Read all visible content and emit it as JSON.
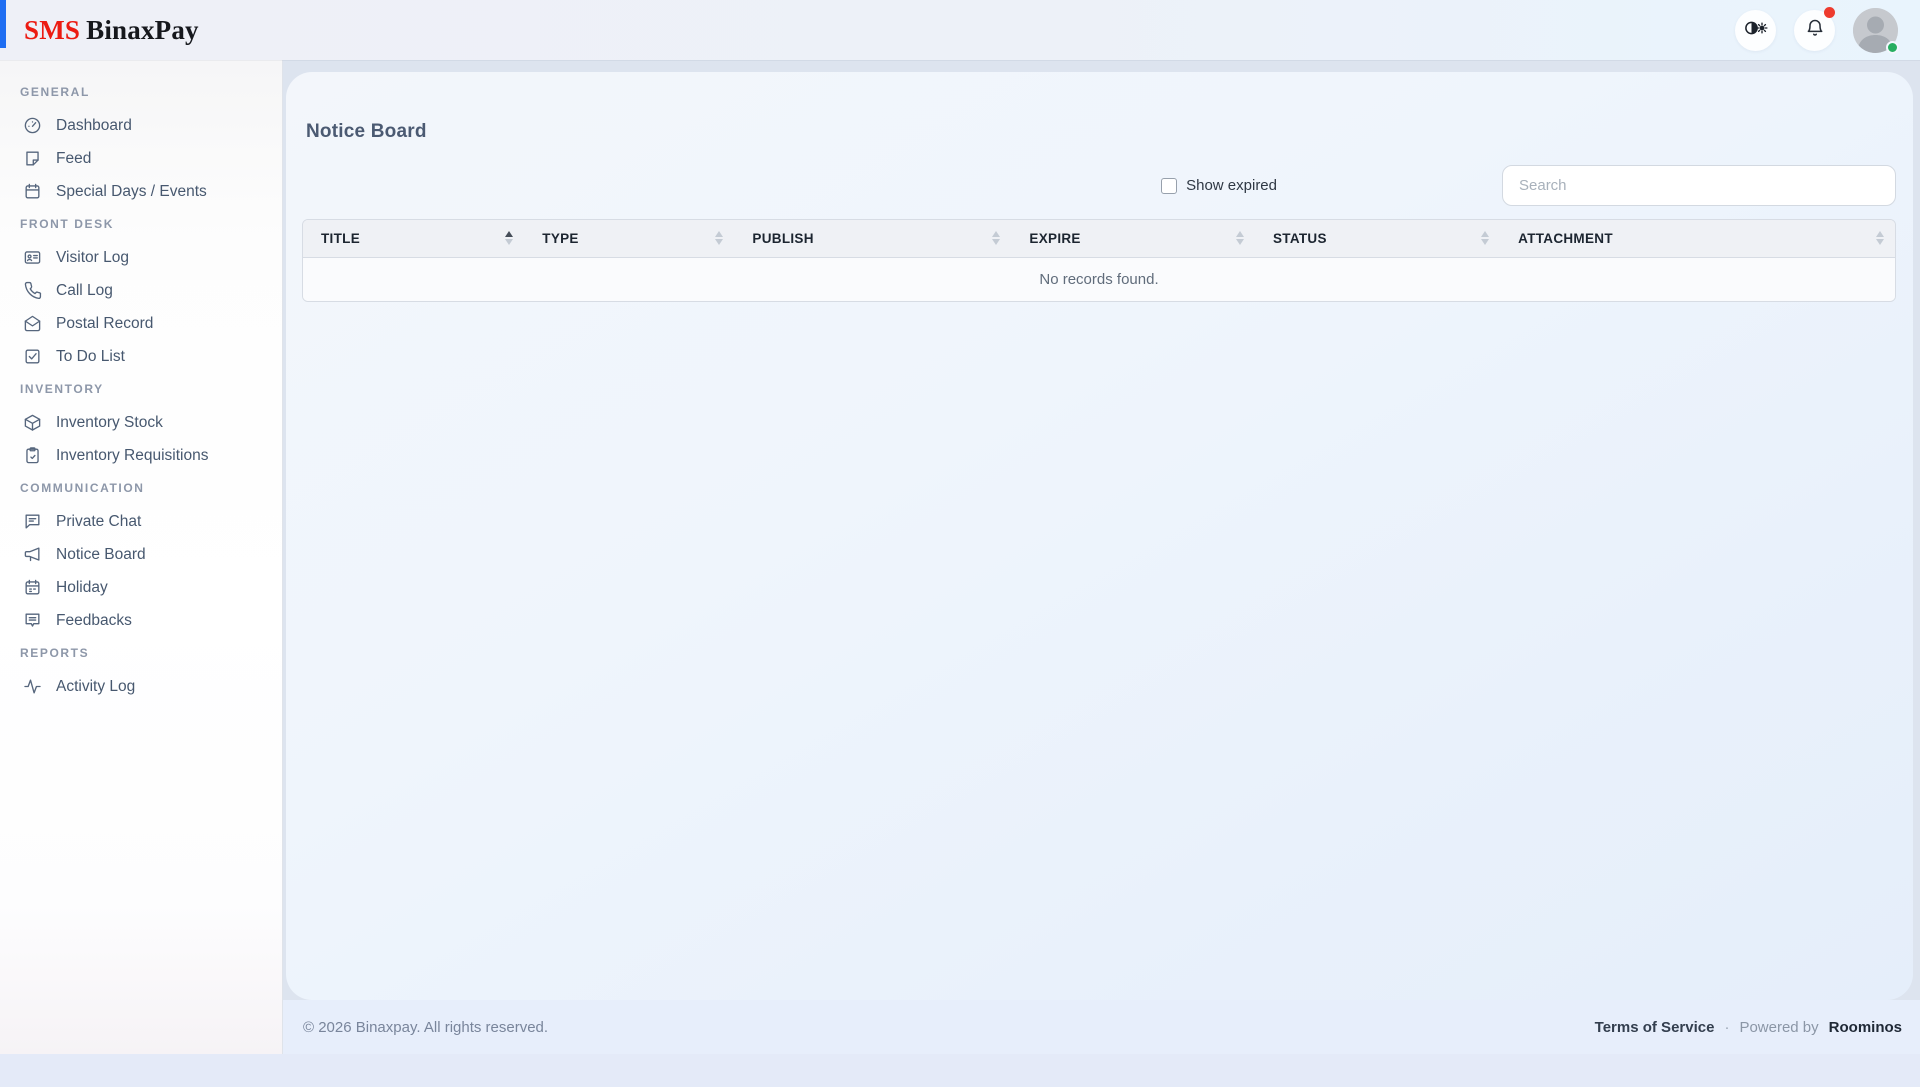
{
  "header": {
    "logo_prefix": "SMS",
    "logo_name": "BinaxPay",
    "icons": [
      "theme-toggle-icon",
      "notifications-bell-icon",
      "user-avatar"
    ],
    "notification_has_alert": true,
    "user_online": true
  },
  "sidebar": {
    "sections": [
      {
        "label": "GENERAL",
        "items": [
          {
            "label": "Dashboard",
            "icon": "dashboard-icon"
          },
          {
            "label": "Feed",
            "icon": "feed-note-icon"
          },
          {
            "label": "Special Days / Events",
            "icon": "calendar-icon"
          }
        ]
      },
      {
        "label": "FRONT DESK",
        "items": [
          {
            "label": "Visitor Log",
            "icon": "id-card-icon"
          },
          {
            "label": "Call Log",
            "icon": "phone-icon"
          },
          {
            "label": "Postal Record",
            "icon": "envelope-open-icon"
          },
          {
            "label": "To Do List",
            "icon": "check-square-icon"
          }
        ]
      },
      {
        "label": "INVENTORY",
        "items": [
          {
            "label": "Inventory Stock",
            "icon": "package-icon"
          },
          {
            "label": "Inventory Requisitions",
            "icon": "clipboard-icon"
          }
        ]
      },
      {
        "label": "COMMUNICATION",
        "items": [
          {
            "label": "Private Chat",
            "icon": "chat-square-icon"
          },
          {
            "label": "Notice Board",
            "icon": "megaphone-icon"
          },
          {
            "label": "Holiday",
            "icon": "calendar-days-icon"
          },
          {
            "label": "Feedbacks",
            "icon": "feedback-bubble-icon"
          }
        ]
      },
      {
        "label": "REPORTS",
        "items": [
          {
            "label": "Activity Log",
            "icon": "activity-icon"
          }
        ]
      }
    ]
  },
  "main": {
    "title": "Notice Board",
    "show_expired_label": "Show expired",
    "show_expired_checked": false,
    "search_placeholder": "Search",
    "table": {
      "columns": [
        {
          "label": "TITLE",
          "sort": "asc"
        },
        {
          "label": "TYPE",
          "sort": "none"
        },
        {
          "label": "PUBLISH",
          "sort": "none"
        },
        {
          "label": "EXPIRE",
          "sort": "none"
        },
        {
          "label": "STATUS",
          "sort": "none"
        },
        {
          "label": "ATTACHMENT",
          "sort": "none"
        }
      ],
      "empty_message": "No records found."
    }
  },
  "footer": {
    "copyright": "© 2026 Binaxpay. All rights reserved.",
    "terms_label": "Terms of Service",
    "separator": "·",
    "powered_by_label": "Powered by",
    "powered_by_brand": "Roominos"
  },
  "colors": {
    "accent_blue": "#1f6ef2",
    "logo_red": "#ec1b12",
    "notification_dot": "#ee3b2e",
    "online_dot": "#27ae60"
  }
}
